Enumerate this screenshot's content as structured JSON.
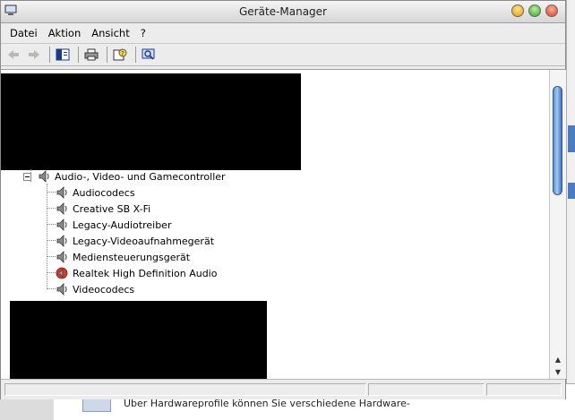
{
  "window": {
    "title": "Geräte-Manager"
  },
  "menu": {
    "items": [
      "Datei",
      "Aktion",
      "Ansicht",
      "?"
    ]
  },
  "toolbar": {
    "buttons": [
      "back-icon",
      "forward-icon",
      "console-tree-icon",
      "print-icon",
      "properties-help-icon",
      "scan-hardware-icon"
    ]
  },
  "tree": {
    "category": "Audio-, Video- und Gamecontroller",
    "children": [
      "Audiocodecs",
      "Creative SB X-Fi",
      "Legacy-Audiotreiber",
      "Legacy-Videoaufnahmegerät",
      "Mediensteuerungsgerät",
      "Realtek High Definition Audio",
      "Videocodecs"
    ]
  },
  "background": {
    "text": "Über Hardwareprofile können Sie verschiedene Hardware-"
  },
  "colors": {
    "accent": "#4a7cc2",
    "thumb": "#5a8fd8"
  }
}
